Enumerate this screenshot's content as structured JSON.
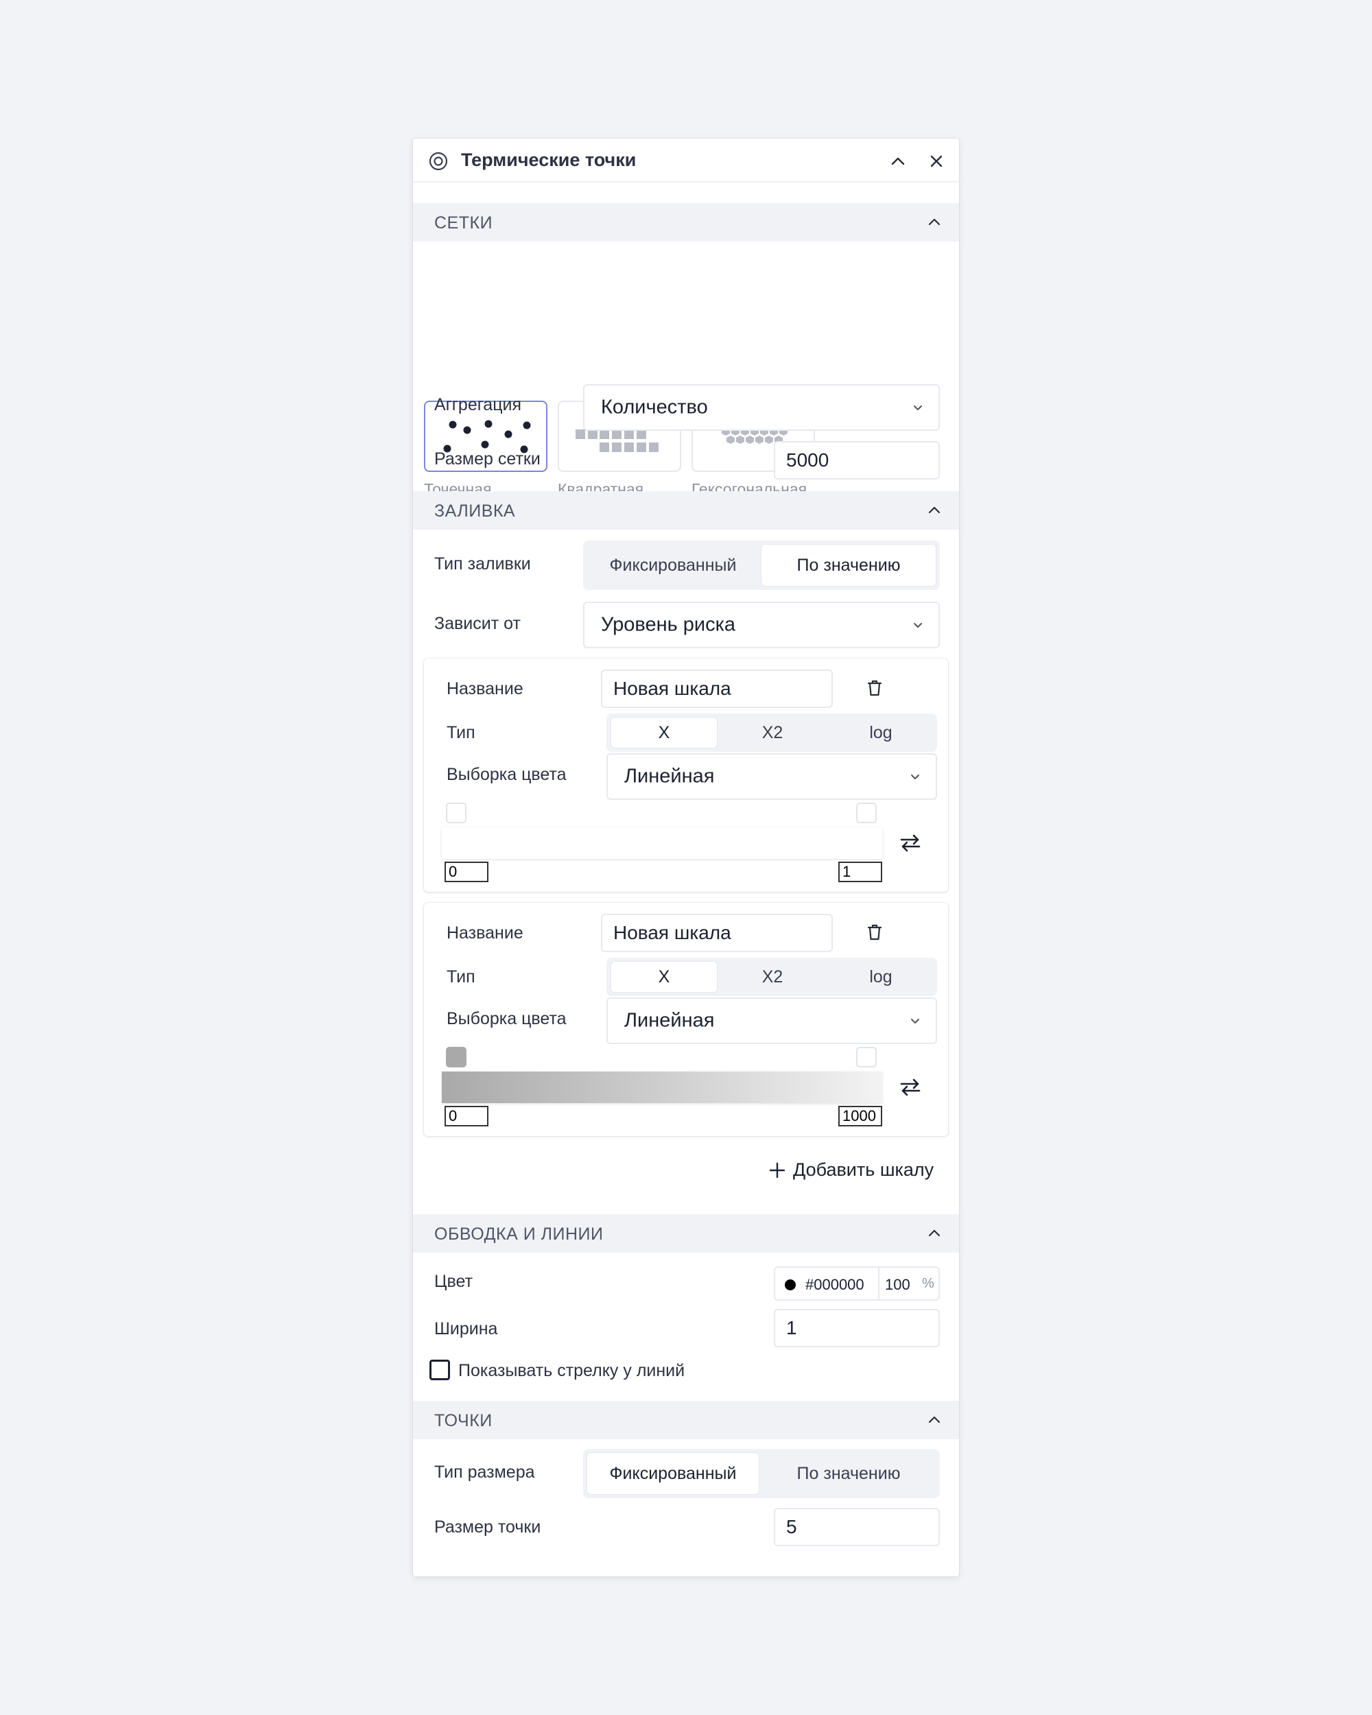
{
  "panel": {
    "title": "Термические точки"
  },
  "sections": {
    "grids": "СЕТКИ",
    "fill": "ЗАЛИВКА",
    "stroke": "ОБВОДКА И ЛИНИИ",
    "points": "ТОЧКИ"
  },
  "grid_types": [
    {
      "label": "Точечная",
      "icon": "dot-grid-icon",
      "selected": true
    },
    {
      "label": "Квадратная",
      "icon": "square-grid-icon",
      "selected": false
    },
    {
      "label": "Гексогональная",
      "icon": "hex-grid-icon",
      "selected": false
    }
  ],
  "aggregation": {
    "label": "Аггрегация",
    "value": "Количество"
  },
  "grid_size": {
    "label": "Размер сетки",
    "value": "5000"
  },
  "fill_type": {
    "label": "Тип заливки",
    "options": [
      "Фиксированный",
      "По значению"
    ],
    "selected": "По значению"
  },
  "depends_on": {
    "label": "Зависит от",
    "value": "Уровень риска"
  },
  "scales": [
    {
      "name_label": "Название",
      "name_value": "Новая шкала",
      "type_label": "Тип",
      "type_options": [
        "X",
        "X2",
        "log"
      ],
      "type_selected": "X",
      "color_label": "Выборка цвета",
      "color_value": "Линейная",
      "min": "0",
      "max": "1",
      "gradient": [
        "#ffffff",
        "#ffffff"
      ]
    },
    {
      "name_label": "Название",
      "name_value": "Новая шкала",
      "type_label": "Тип",
      "type_options": [
        "X",
        "X2",
        "log"
      ],
      "type_selected": "X",
      "color_label": "Выборка цвета",
      "color_value": "Линейная",
      "min": "0",
      "max": "1000",
      "gradient": [
        "#a9a9a9",
        "#f3f3f3"
      ]
    }
  ],
  "add_scale": "Добавить шкалу",
  "stroke": {
    "color_label": "Цвет",
    "color_hex": "#000000",
    "opacity": "100",
    "opacity_unit": "%",
    "width_label": "Ширина",
    "width_value": "1",
    "arrow_label": "Показывать стрелку у линий",
    "arrow_checked": false
  },
  "points": {
    "size_type_label": "Тип размера",
    "size_type_options": [
      "Фиксированный",
      "По значению"
    ],
    "size_type_selected": "Фиксированный",
    "size_label": "Размер точки",
    "size_value": "5"
  },
  "colors": {
    "accent": "#7a86e0",
    "section_bg": "#f1f2f6"
  }
}
